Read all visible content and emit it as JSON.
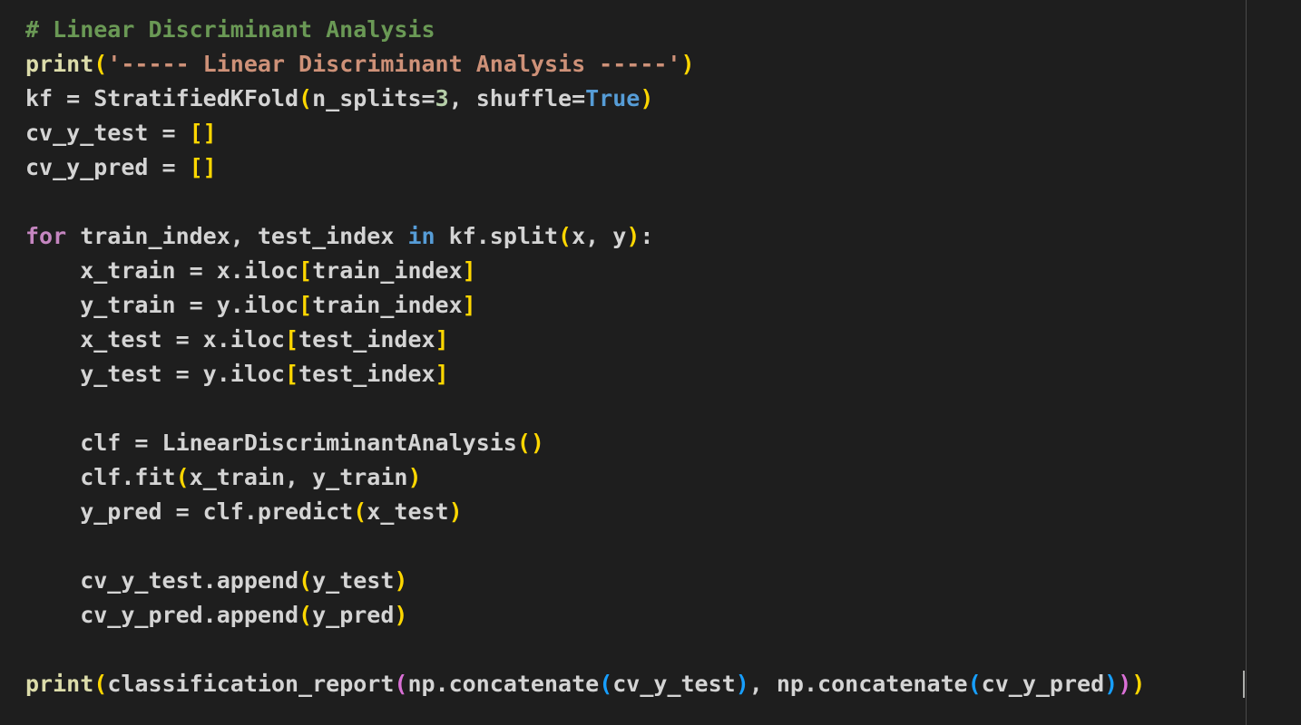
{
  "editor": {
    "theme_colors": {
      "background": "#1e1e1e",
      "comment": "#6a9955",
      "function": "#dcdcaa",
      "string": "#ce9178",
      "number": "#b5cea8",
      "constant": "#569cd6",
      "keyword": "#c586c0",
      "bracket_level_1": "#ffd700",
      "bracket_level_2": "#da70d6",
      "bracket_level_3": "#179fff"
    },
    "lines": [
      [
        {
          "t": "# Linear Discriminant Analysis",
          "c": "comment"
        }
      ],
      [
        {
          "t": "print",
          "c": "func"
        },
        {
          "t": "(",
          "c": "b1"
        },
        {
          "t": "'----- Linear Discriminant Analysis -----'",
          "c": "string"
        },
        {
          "t": ")",
          "c": "b1"
        }
      ],
      [
        {
          "t": "kf = StratifiedKFold",
          "c": "plain"
        },
        {
          "t": "(",
          "c": "b1"
        },
        {
          "t": "n_splits=",
          "c": "plain"
        },
        {
          "t": "3",
          "c": "number"
        },
        {
          "t": ", shuffle=",
          "c": "plain"
        },
        {
          "t": "True",
          "c": "const"
        },
        {
          "t": ")",
          "c": "b1"
        }
      ],
      [
        {
          "t": "cv_y_test = ",
          "c": "plain"
        },
        {
          "t": "[]",
          "c": "b1"
        }
      ],
      [
        {
          "t": "cv_y_pred = ",
          "c": "plain"
        },
        {
          "t": "[]",
          "c": "b1"
        }
      ],
      [],
      [
        {
          "t": "for",
          "c": "keyword"
        },
        {
          "t": " train_index, test_index ",
          "c": "plain"
        },
        {
          "t": "in",
          "c": "in"
        },
        {
          "t": " kf.split",
          "c": "plain"
        },
        {
          "t": "(",
          "c": "b1"
        },
        {
          "t": "x, y",
          "c": "plain"
        },
        {
          "t": ")",
          "c": "b1"
        },
        {
          "t": ":",
          "c": "plain"
        }
      ],
      [
        {
          "t": "    x_train = x.iloc",
          "c": "plain"
        },
        {
          "t": "[",
          "c": "b1"
        },
        {
          "t": "train_index",
          "c": "plain"
        },
        {
          "t": "]",
          "c": "b1"
        }
      ],
      [
        {
          "t": "    y_train = y.iloc",
          "c": "plain"
        },
        {
          "t": "[",
          "c": "b1"
        },
        {
          "t": "train_index",
          "c": "plain"
        },
        {
          "t": "]",
          "c": "b1"
        }
      ],
      [
        {
          "t": "    x_test = x.iloc",
          "c": "plain"
        },
        {
          "t": "[",
          "c": "b1"
        },
        {
          "t": "test_index",
          "c": "plain"
        },
        {
          "t": "]",
          "c": "b1"
        }
      ],
      [
        {
          "t": "    y_test = y.iloc",
          "c": "plain"
        },
        {
          "t": "[",
          "c": "b1"
        },
        {
          "t": "test_index",
          "c": "plain"
        },
        {
          "t": "]",
          "c": "b1"
        }
      ],
      [],
      [
        {
          "t": "    clf = LinearDiscriminantAnalysis",
          "c": "plain"
        },
        {
          "t": "()",
          "c": "b1"
        }
      ],
      [
        {
          "t": "    clf.fit",
          "c": "plain"
        },
        {
          "t": "(",
          "c": "b1"
        },
        {
          "t": "x_train, y_train",
          "c": "plain"
        },
        {
          "t": ")",
          "c": "b1"
        }
      ],
      [
        {
          "t": "    y_pred = clf.predict",
          "c": "plain"
        },
        {
          "t": "(",
          "c": "b1"
        },
        {
          "t": "x_test",
          "c": "plain"
        },
        {
          "t": ")",
          "c": "b1"
        }
      ],
      [],
      [
        {
          "t": "    cv_y_test.append",
          "c": "plain"
        },
        {
          "t": "(",
          "c": "b1"
        },
        {
          "t": "y_test",
          "c": "plain"
        },
        {
          "t": ")",
          "c": "b1"
        }
      ],
      [
        {
          "t": "    cv_y_pred.append",
          "c": "plain"
        },
        {
          "t": "(",
          "c": "b1"
        },
        {
          "t": "y_pred",
          "c": "plain"
        },
        {
          "t": ")",
          "c": "b1"
        }
      ],
      [],
      [
        {
          "t": "print",
          "c": "func"
        },
        {
          "t": "(",
          "c": "b1"
        },
        {
          "t": "classification_report",
          "c": "plain"
        },
        {
          "t": "(",
          "c": "b2"
        },
        {
          "t": "np.concatenate",
          "c": "plain"
        },
        {
          "t": "(",
          "c": "b3"
        },
        {
          "t": "cv_y_test",
          "c": "plain"
        },
        {
          "t": ")",
          "c": "b3"
        },
        {
          "t": ", np.concatenate",
          "c": "plain"
        },
        {
          "t": "(",
          "c": "b3"
        },
        {
          "t": "cv_y_pred",
          "c": "plain"
        },
        {
          "t": ")",
          "c": "b3"
        },
        {
          "t": ")",
          "c": "b2"
        },
        {
          "t": ")",
          "c": "b1"
        }
      ]
    ]
  }
}
